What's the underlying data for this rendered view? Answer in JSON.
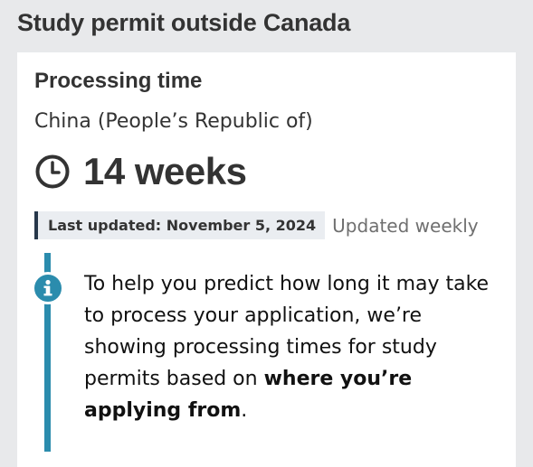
{
  "page": {
    "title": "Study permit outside Canada"
  },
  "card": {
    "heading": "Processing time",
    "country": "China (People’s Republic of)",
    "processing_time": "14 weeks",
    "last_updated": "Last updated: November 5, 2024",
    "update_frequency": "Updated weekly"
  },
  "info": {
    "text_part1": "To help you predict how long it may take to process your application, we’re showing processing times for study permits based on ",
    "text_bold": "where you’re applying from",
    "text_part2": "."
  },
  "colors": {
    "background": "#e8e9eb",
    "card": "#ffffff",
    "info_accent": "#2b8cad",
    "badge_border": "#26374a",
    "badge_bg": "#eaedf1"
  },
  "icons": {
    "clock": "clock-icon",
    "info": "info-icon"
  }
}
